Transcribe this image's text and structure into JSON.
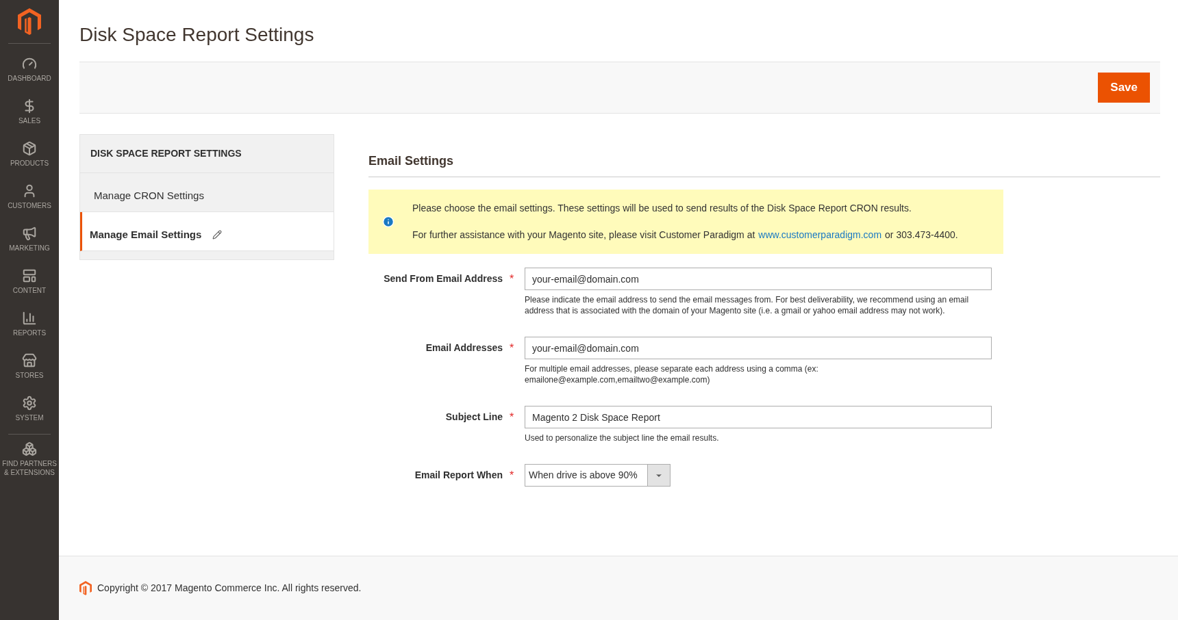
{
  "sidebar": {
    "items": [
      {
        "label": "DASHBOARD"
      },
      {
        "label": "SALES"
      },
      {
        "label": "PRODUCTS"
      },
      {
        "label": "CUSTOMERS"
      },
      {
        "label": "MARKETING"
      },
      {
        "label": "CONTENT"
      },
      {
        "label": "REPORTS"
      },
      {
        "label": "STORES"
      },
      {
        "label": "SYSTEM"
      },
      {
        "label": "FIND PARTNERS & EXTENSIONS"
      }
    ]
  },
  "page_title": "Disk Space Report Settings",
  "save_button": "Save",
  "settings_nav": {
    "title": "DISK SPACE REPORT SETTINGS",
    "items": [
      {
        "label": "Manage CRON Settings",
        "selected": false
      },
      {
        "label": "Manage Email Settings",
        "selected": true
      }
    ]
  },
  "section_title": "Email Settings",
  "notice": {
    "line_1": "Please choose the email settings. These settings will be used to send results of the Disk Space Report CRON results.",
    "line_2_before": "For further assistance with your Magento site, please visit Customer Paradigm at",
    "link": "www.customerparadigm.com",
    "line_2_after": "or 303.473-4400."
  },
  "fields": [
    {
      "kind": "text",
      "label": "Send From Email Address",
      "required_mark": "*",
      "value": "your-email@domain.com",
      "note": "Please indicate the email address to send the email messages from. For best deliverability, we recommend using an email address that is associated with the domain of your Magento site (i.e. a gmail or yahoo email address may not work)."
    },
    {
      "kind": "text",
      "label": "Email Addresses",
      "required_mark": "*",
      "value": "your-email@domain.com",
      "note": "For multiple email addresses, please separate each address using a comma (ex: emailone@example.com,emailtwo@example.com)"
    },
    {
      "kind": "text",
      "label": "Subject Line",
      "required_mark": "*",
      "value": "Magento 2 Disk Space Report",
      "note": "Used to personalize the subject line the email results."
    },
    {
      "kind": "select",
      "label": "Email Report When",
      "required_mark": "*",
      "value": "When drive is above 90%"
    }
  ],
  "footer": {
    "copyright": "Copyright © 2017 Magento Commerce Inc. All rights reserved."
  }
}
